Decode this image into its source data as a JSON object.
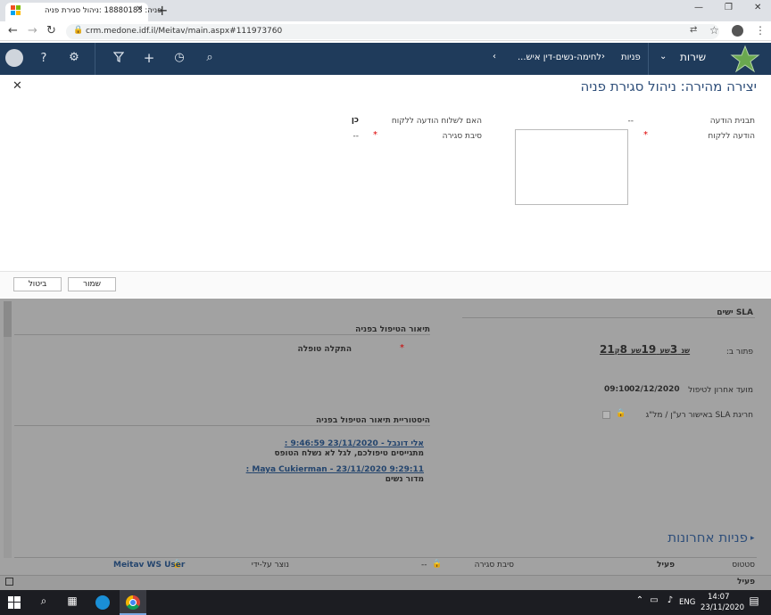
{
  "browser": {
    "tab_title": "פניה: 18880183 :ניהול סגירת פניה",
    "url": "crm.medone.idf.il/Meitav/main.aspx#111973760",
    "window_controls": {
      "minimize": "—",
      "maximize": "❐",
      "close": "✕"
    },
    "new_tab": "+"
  },
  "crm_nav": {
    "app_name": "שירות",
    "breadcrumb_1": "פניות",
    "breadcrumb_2": "לחימה-נשים-דין איש...",
    "chevron": "‹"
  },
  "dialog": {
    "title": "יצירה מהירה: ניהול סגירת פניה",
    "close": "✕",
    "fields": {
      "template_label": "תבנית הודעה",
      "template_value": "--",
      "send_label": "האם לשלוח הודעה ללקוח",
      "send_value": "כן",
      "message_label": "הודעה ללקוח",
      "reason_label": "סיבת סגירה",
      "reason_value": "--",
      "required_mark": "*"
    },
    "buttons": {
      "save": "שמור",
      "cancel": "ביטול"
    }
  },
  "form": {
    "sla_header": "SLA ישים",
    "treatment_header": "תיאור הטיפול בפניה",
    "solved_label": "פתור ב:",
    "sla_timer": {
      "minutes": "21",
      "minutes_unit": "שנ",
      "hours": "3",
      "hours_unit": "שע",
      "days": "19",
      "days_unit": "שע",
      "extra": "8",
      "extra_unit": "ק"
    },
    "treatment_value": "התקלה טופלה",
    "last_date_label": "מועד אחרון לטיפול",
    "last_date_date": "02/12/2020",
    "last_date_time": "09:10",
    "sla_violation_label": "חריגת SLA באישור רע\"ן / מל\"ג",
    "history_header": "היסטוריית תיאור הטיפול בפניה",
    "history": [
      {
        "link": "אלי דונבל - 23/11/2020 9:46:59 :",
        "text": "מתגייסים טיפולכם, לגל לא נשלח הטופס"
      },
      {
        "link": "Maya Cukierman - 23/11/2020 9:29:11 :",
        "text": "מדור נשים"
      }
    ],
    "recent_header": "פניות אחרונות",
    "bottom_row": {
      "status_label": "סטטוס",
      "status_value": "פעיל",
      "reason_label": "סיבת סגירה",
      "reason_value": "--",
      "created_by_label": "נוצר על-ידי",
      "created_by_value": "Meitav WS User"
    },
    "status_bar": "פעיל"
  },
  "taskbar": {
    "time": "14:07",
    "date": "23/11/2020",
    "lang": "ENG"
  }
}
